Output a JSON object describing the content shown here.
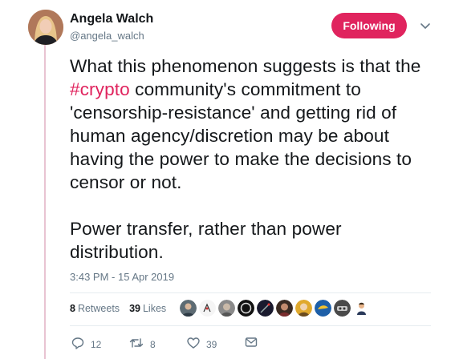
{
  "author": {
    "name": "Angela Walch",
    "handle": "@angela_walch"
  },
  "follow_button": {
    "label": "Following"
  },
  "tweet": {
    "line1_before": "What this phenomenon suggests is that the ",
    "hashtag": "#crypto",
    "line1_after": " community's commitment to 'censorship-resistance' and getting rid of human agency/discretion may be about having the power to make the decisions to censor or not.",
    "paragraph2": "Power transfer, rather than power distribution."
  },
  "timestamp": "3:43 PM - 15 Apr 2019",
  "stats": {
    "retweets_count": "8",
    "retweets_label": "Retweets",
    "likes_count": "39",
    "likes_label": "Likes"
  },
  "actions": {
    "reply_count": "12",
    "retweet_count": "8",
    "like_count": "39"
  },
  "colors": {
    "accent": "#e0245e",
    "muted": "#657786",
    "text": "#14171a",
    "thread_line": "#e8c4d2"
  },
  "icons": [
    "reply-icon",
    "retweet-icon",
    "heart-icon",
    "envelope-icon",
    "chevron-down-icon"
  ]
}
